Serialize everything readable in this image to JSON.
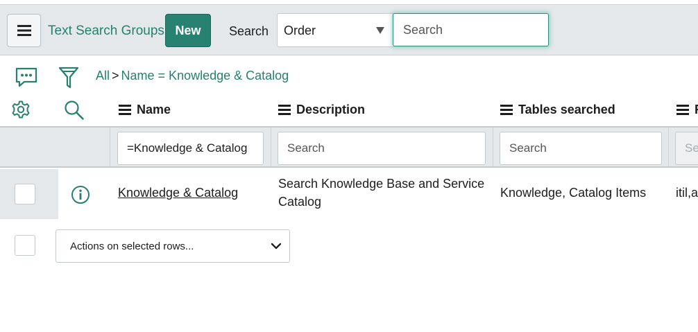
{
  "header": {
    "title": "Text Search Groups",
    "new_label": "New",
    "search_label": "Search",
    "search_field_selected": "Order",
    "search_placeholder": "Search"
  },
  "breadcrumb": {
    "all": "All",
    "separator": ">",
    "condition": "Name = Knowledge & Catalog"
  },
  "icons": {
    "menu": "hamburger-menu-icon",
    "activity": "chat-bubble-icon",
    "filter": "funnel-icon",
    "settings": "gear-icon",
    "search": "magnifier-icon",
    "info": "info-circle-icon",
    "dropdown": "chevron-down-icon"
  },
  "columns": [
    "Name",
    "Description",
    "Tables searched",
    "R"
  ],
  "filters": {
    "name_value": "=Knowledge & Catalog",
    "description_placeholder": "Search",
    "tables_placeholder": "Search",
    "fourth_placeholder": "Search"
  },
  "rows": [
    {
      "name": "Knowledge & Catalog",
      "description": "Search Knowledge Base and Service Catalog",
      "tables_searched": "Knowledge, Catalog Items",
      "roles": "itil,admin"
    }
  ],
  "actions": {
    "label": "Actions on selected rows..."
  },
  "colors": {
    "accent": "#278272",
    "link": "#26806f",
    "header_bg": "#e4e8ea"
  }
}
